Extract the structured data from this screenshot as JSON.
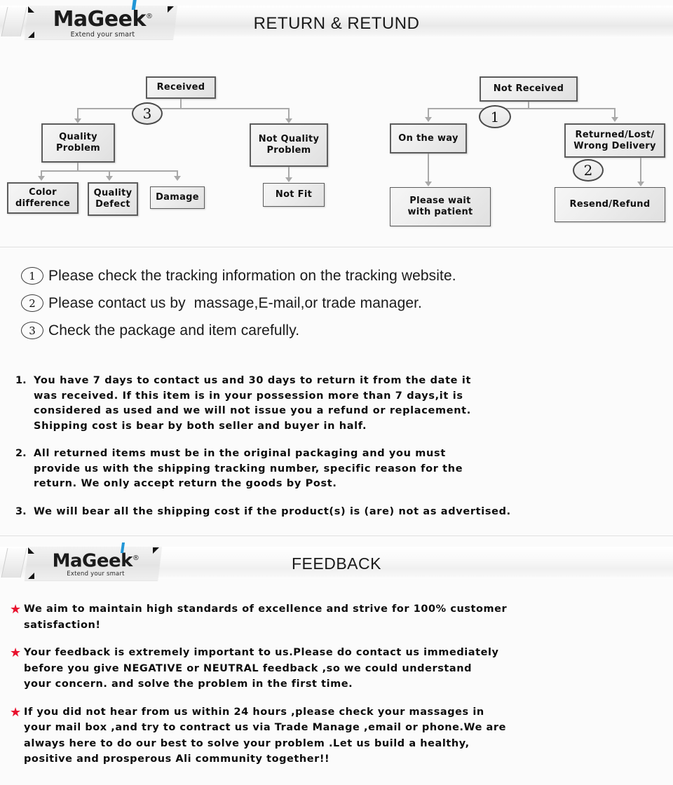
{
  "brand": {
    "name_prefix": "MaGee",
    "name_suffix": "k",
    "registered": "®",
    "tagline": "Extend your smart",
    "blue_hex": "#2196d6"
  },
  "banner_top": {
    "title": "RETURN & RETUND"
  },
  "banner_bottom": {
    "title": "FEEDBACK"
  },
  "flowchart": {
    "left_tree": {
      "root": "Received",
      "marker": "3",
      "children": [
        {
          "label": "Quality\nProblem"
        },
        {
          "label": "Not Quality\nProblem"
        }
      ],
      "grandchildren_left": [
        {
          "label": "Color\ndifference"
        },
        {
          "label": "Quality\nDefect"
        },
        {
          "label": "Damage"
        }
      ],
      "grandchildren_right": [
        {
          "label": "Not Fit"
        }
      ]
    },
    "right_tree": {
      "root": "Not  Received",
      "marker_top": "1",
      "marker_mid": "2",
      "children": [
        {
          "label": "On the way"
        },
        {
          "label": "Returned/Lost/\nWrong Delivery"
        }
      ],
      "grandchildren": [
        {
          "label": "Please wait\nwith patient"
        },
        {
          "label": "Resend/Refund"
        }
      ]
    }
  },
  "instructions": [
    {
      "num": "1",
      "text": "Please check the tracking information on the tracking website."
    },
    {
      "num": "2",
      "text": "Please contact us by  massage,E-mail,or trade manager."
    },
    {
      "num": "3",
      "text": "Check the package and item carefully."
    }
  ],
  "policy": [
    {
      "num": "1.",
      "text": "You have 7 days to contact us and 30 days to return it from the date it\nwas received. If this item is in your possession more than 7 days,it is\nconsidered as used and we will not issue you a refund or replacement.\nShipping cost is bear by both seller and buyer in half."
    },
    {
      "num": "2.",
      "text": "All returned items must be in the original packaging and you must\nprovide us with the shipping tracking number, specific reason for the\nreturn. We only accept return the goods by Post."
    },
    {
      "num": "3.",
      "text": "We will bear all the shipping cost if the product(s) is (are) not as advertised."
    }
  ],
  "feedback": {
    "star_glyph": "★",
    "star_hex": "#e8112d",
    "items": [
      {
        "text": "We aim to maintain high standards of excellence and strive  for 100% customer\nsatisfaction!"
      },
      {
        "text": "Your feedback is extremely important to us.Please do contact us immediately\nbefore you give NEGATIVE or NEUTRAL feedback ,so  we could understand\nyour concern. and solve the problem in the first time."
      },
      {
        "text": "If you did not hear from us within 24 hours ,please check your massages in\nyour mail box ,and try to contract us via Trade Manage ,email or phone.We are\nalways here to do our best to solve your problem .Let us build a healthy,\npositive and prosperous Ali community together!!"
      }
    ]
  }
}
